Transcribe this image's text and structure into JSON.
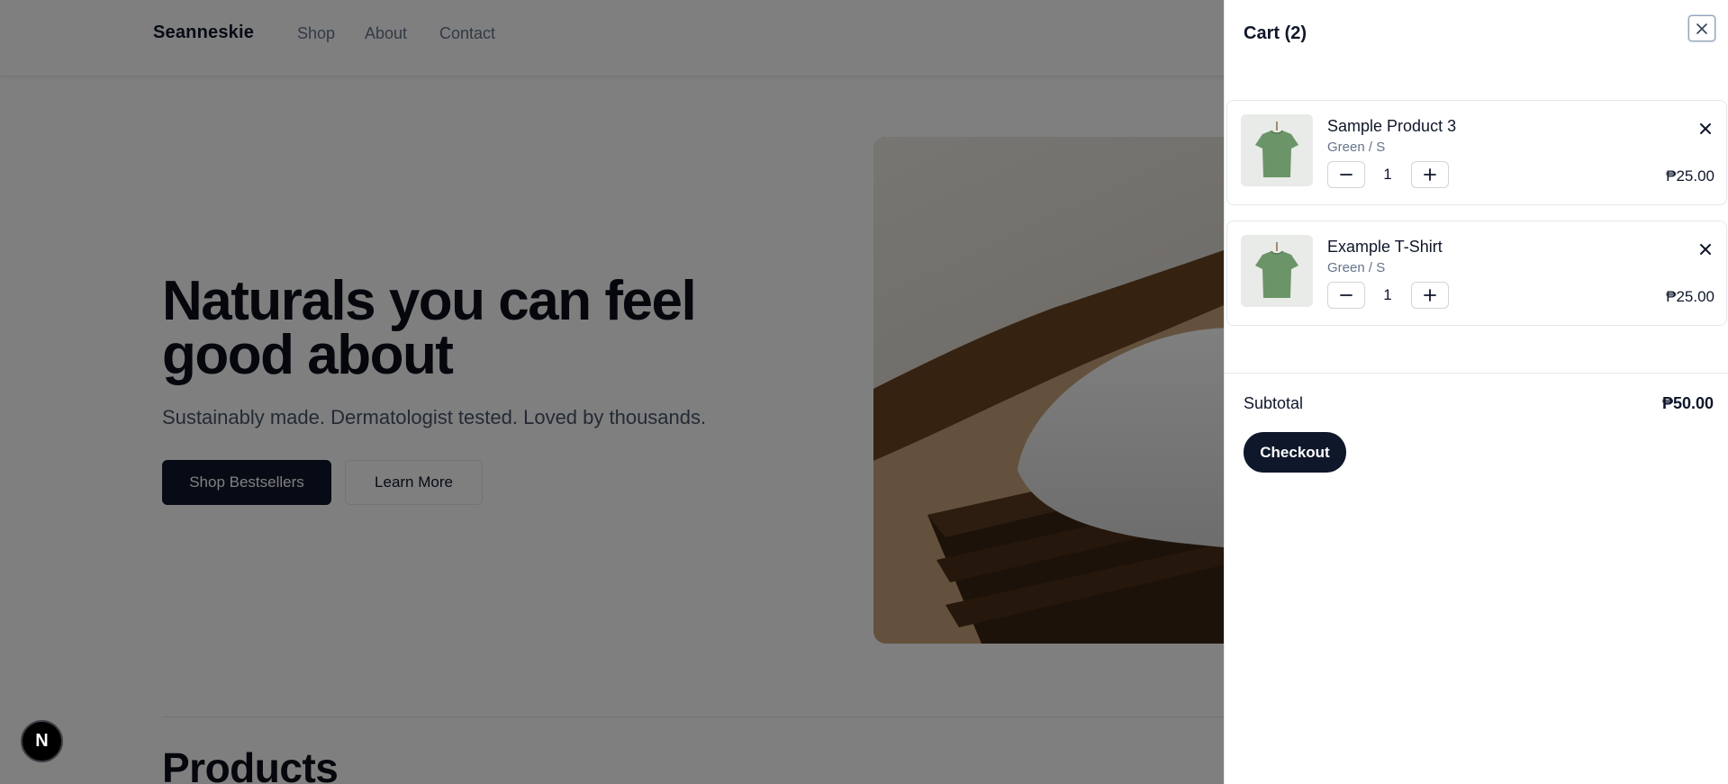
{
  "nav": {
    "brand": "Seanneskie",
    "links": [
      "Shop",
      "About",
      "Contact"
    ]
  },
  "hero": {
    "title": "Naturals you can feel good about",
    "subtitle": "Sustainably made. Dermatologist tested. Loved by thousands.",
    "primary_button": "Shop Bestsellers",
    "secondary_button": "Learn More"
  },
  "products": {
    "heading": "Products"
  },
  "dev_badge": {
    "label": "N"
  },
  "cart": {
    "title": "Cart (2)",
    "items": [
      {
        "name": "Sample Product 3",
        "variant": "Green / S",
        "quantity": "1",
        "price": "₱25.00"
      },
      {
        "name": "Example T-Shirt",
        "variant": "Green / S",
        "quantity": "1",
        "price": "₱25.00"
      }
    ],
    "subtotal_label": "Subtotal",
    "subtotal_value": "₱50.00",
    "checkout_label": "Checkout"
  },
  "colors": {
    "primary": "#0f172a",
    "overlay": "rgba(0,0,0,0.5)",
    "shirt": "#6b9568"
  },
  "icons": {
    "close": "close-icon",
    "minus": "minus-icon",
    "plus": "plus-icon",
    "remove": "remove-item-icon"
  }
}
